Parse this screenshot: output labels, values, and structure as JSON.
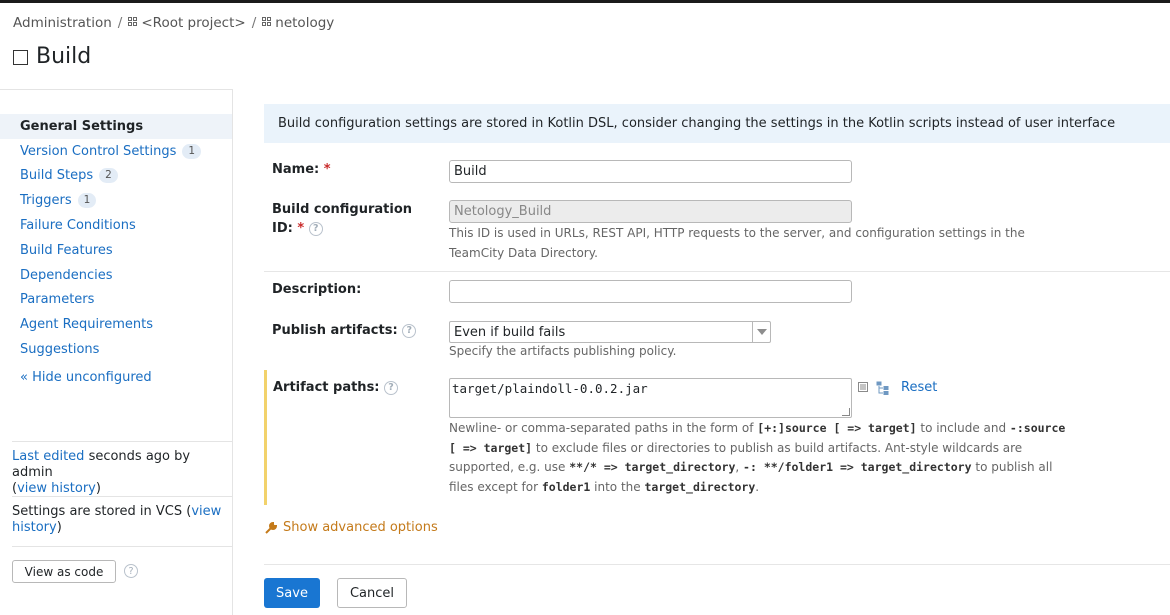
{
  "breadcrumb": {
    "admin": "Administration",
    "separator": "/",
    "root_project": "<Root project>",
    "project": "netology"
  },
  "page_title": "Build",
  "sidebar": {
    "items": [
      {
        "label": "General Settings",
        "count": null,
        "active": true
      },
      {
        "label": "Version Control Settings",
        "count": "1"
      },
      {
        "label": "Build Steps",
        "count": "2"
      },
      {
        "label": "Triggers",
        "count": "1"
      },
      {
        "label": "Failure Conditions",
        "count": null
      },
      {
        "label": "Build Features",
        "count": null
      },
      {
        "label": "Dependencies",
        "count": null
      },
      {
        "label": "Parameters",
        "count": null
      },
      {
        "label": "Agent Requirements",
        "count": null
      },
      {
        "label": "Suggestions",
        "count": null
      }
    ],
    "hide_unconfigured": "« Hide unconfigured",
    "last_edited_link": "Last edited",
    "last_edited_text": "seconds ago by admin",
    "view_history_1": "view history",
    "vcs_text": "Settings are stored in VCS",
    "view_history_2a": "view",
    "view_history_2b": "history",
    "view_as_code": "View as code",
    "help_glyph": "?"
  },
  "info_banner": "Build configuration settings are stored in Kotlin DSL, consider changing the settings in the Kotlin scripts instead of user interface",
  "form": {
    "name_label": "Name:",
    "name_value": "Build",
    "required_mark": "*",
    "id_label_1": "Build configuration",
    "id_label_2": "ID:",
    "id_value": "Netology_Build",
    "id_note": "This ID is used in URLs, REST API, HTTP requests to the server, and configuration settings in the TeamCity Data Directory.",
    "description_label": "Description:",
    "description_value": "",
    "publish_label": "Publish artifacts:",
    "publish_value": "Even if build fails",
    "publish_note": "Specify the artifacts publishing policy.",
    "artifact_label": "Artifact paths:",
    "artifact_value": "target/plaindoll-0.0.2.jar",
    "reset_label": "Reset",
    "artifact_note": {
      "p1": "Newline- or comma-separated paths in the form of",
      "c1": "[+:]source [ => target]",
      "p2": "to include and",
      "c2": "-:source [ => target]",
      "p3": "to exclude files or directories to publish as build artifacts. Ant-style wildcards are supported, e.g. use",
      "c3": "**/* => target_directory",
      "p4": ",",
      "c4": "-: **/folder1 => target_directory",
      "p5": "to publish all files except for",
      "c5": "folder1",
      "p6": "into the",
      "c6": "target_directory",
      "p7": "."
    },
    "advanced_label": "Show advanced options"
  },
  "buttons": {
    "save": "Save",
    "cancel": "Cancel"
  }
}
